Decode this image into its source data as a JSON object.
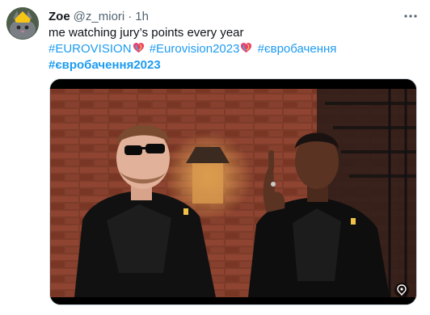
{
  "author": {
    "display_name": "Zoe",
    "handle": "@z_miori",
    "separator": "·",
    "time": "1h",
    "avatar_icon": "cat-avatar-icon"
  },
  "tweet": {
    "line1": "me watching jury’s points every year",
    "tags_line2": [
      "#EUROVISION",
      "#Eurovision2023",
      "#євробачення"
    ],
    "tags_line3": [
      "#євробачення2023"
    ]
  },
  "icons": {
    "more": "more-options-icon",
    "heart": "eurovision-heart-icon",
    "media_badge": "media-badge-icon"
  },
  "colors": {
    "link": "#1d9bf0",
    "secondary_text": "#536471",
    "primary_text": "#0f1419"
  }
}
